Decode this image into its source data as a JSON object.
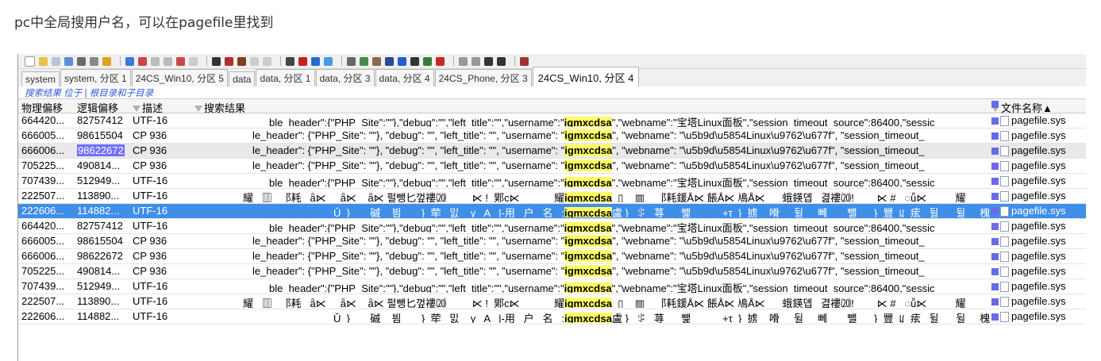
{
  "heading": "pc中全局搜用户名，可以在pagefile里找到",
  "tabs": [
    {
      "label": "system"
    },
    {
      "label": "system, 分区 1"
    },
    {
      "label": "24CS_Win10, 分区 5"
    },
    {
      "label": "data"
    },
    {
      "label": "data, 分区 1"
    },
    {
      "label": "data, 分区 3"
    },
    {
      "label": "data, 分区 4"
    },
    {
      "label": "24CS_Phone, 分区 3"
    },
    {
      "label": "24CS_Win10, 分区 4",
      "active": true
    }
  ],
  "breadcrumb": "搜索结果 位于 | 根目录和子目录",
  "columns": {
    "phys": "物理偏移",
    "logi": "逻辑偏移",
    "desc": "描述",
    "result": "搜索结果",
    "filename": "文件名称▲"
  },
  "keyword": "igmxcdsa",
  "rows": [
    {
      "phys": "664420...",
      "logi": "82757412",
      "desc": "UTF-16",
      "pre": "ble_header\":{\"PHP_Site\":\"\"},\"debug\":\"\",\"left_title\":\"\",\"username\":\"",
      "post": "\",\"webname\":\"宝塔Linux面板\",\"session_timeout_source\":86400,\"sessic",
      "file": "pagefile.sys"
    },
    {
      "phys": "666005...",
      "logi": "98615504",
      "desc": "CP 936",
      "pre": "le_header\": {\"PHP_Site\": \"\"}, \"debug\": \"\", \"left_title\": \"\", \"username\": \"",
      "post": "\", \"webname\": \"\\u5b9d\\u5854Linux\\u9762\\u677f\", \"session_timeout_",
      "file": "pagefile.sys"
    },
    {
      "phys": "666006...",
      "logi": "98622672",
      "desc": "CP 936",
      "pre": "le_header\": {\"PHP_Site\": \"\"}, \"debug\": \"\", \"left_title\": \"\", \"username\": \"",
      "post": "\", \"webname\": \"\\u5b9d\\u5854Linux\\u9762\\u677f\", \"session_timeout_",
      "file": "pagefile.sys",
      "logi_hl": true,
      "style": "hl2"
    },
    {
      "phys": "705225...",
      "logi": "490814...",
      "desc": "CP 936",
      "pre": "le_header\": {\"PHP_Site\": \"\"}, \"debug\": \"\", \"left_title\": \"\", \"username\": \"",
      "post": "\", \"webname\": \"\\u5b9d\\u5854Linux\\u9762\\u677f\", \"session_timeout_",
      "file": "pagefile.sys"
    },
    {
      "phys": "707439...",
      "logi": "512949...",
      "desc": "UTF-16",
      "pre": "ble_header\":{\"PHP_Site\":\"\"},\"debug\":\"\",\"left_title\":\"\",\"username\":\"",
      "post": "\",\"webname\":\"宝塔Linux面板\",\"session_timeout_source\":86400,\"sessic",
      "file": "pagefile.sys"
    },
    {
      "phys": "222507...",
      "logi": "113890...",
      "desc": "UTF-16",
      "pre": "耀   ▥   ⻏耗   ǟ⋉     ǟ⋉    ǟ⋉ 펄뺑⼔껖褸⒇         ⋉ !  郹c⋉            耀",
      "post": "  ▯    ▥    ⻏耗鍰Å⋉ 餦Å⋉ 鳰Å⋉      蛾鍈뎹   겶褸⒇!        ⋉ #   ◌ǚ⋉          耀",
      "file": "pagefile.sys"
    },
    {
      "phys": "222606...",
      "logi": "114882...",
      "desc": "UTF-16",
      "pre": "Ǔ  }       磩    븸       }  荦   밄    y   A   |-用   户   名   :",
      "post": "盧 }   ꌒ   荨      뺉           +τ  }  掳    嗗     뒬     뻬       뺄      }  豐  ꡊ  痃   뒬      뒬     槐   ꜰ",
      "file": "pagefile.sys",
      "style": "sel"
    },
    {
      "phys": "664420...",
      "logi": "82757412",
      "desc": "UTF-16",
      "pre": "ble_header\":{\"PHP_Site\":\"\"},\"debug\":\"\",\"left_title\":\"\",\"username\":\"",
      "post": "\",\"webname\":\"宝塔Linux面板\",\"session_timeout_source\":86400,\"sessic",
      "file": "pagefile.sys"
    },
    {
      "phys": "666005...",
      "logi": "98615504",
      "desc": "CP 936",
      "pre": "le_header\": {\"PHP_Site\": \"\"}, \"debug\": \"\", \"left_title\": \"\", \"username\": \"",
      "post": "\", \"webname\": \"\\u5b9d\\u5854Linux\\u9762\\u677f\", \"session_timeout_",
      "file": "pagefile.sys"
    },
    {
      "phys": "666006...",
      "logi": "98622672",
      "desc": "CP 936",
      "pre": "le_header\": {\"PHP_Site\": \"\"}, \"debug\": \"\", \"left_title\": \"\", \"username\": \"",
      "post": "\", \"webname\": \"\\u5b9d\\u5854Linux\\u9762\\u677f\", \"session_timeout_",
      "file": "pagefile.sys"
    },
    {
      "phys": "705225...",
      "logi": "490814...",
      "desc": "CP 936",
      "pre": "le_header\": {\"PHP_Site\": \"\"}, \"debug\": \"\", \"left_title\": \"\", \"username\": \"",
      "post": "\", \"webname\": \"\\u5b9d\\u5854Linux\\u9762\\u677f\", \"session_timeout_",
      "file": "pagefile.sys"
    },
    {
      "phys": "707439...",
      "logi": "512949...",
      "desc": "UTF-16",
      "pre": "ble_header\":{\"PHP_Site\":\"\"},\"debug\":\"\",\"left_title\":\"\",\"username\":\"",
      "post": "\",\"webname\":\"宝塔Linux面板\",\"session_timeout_source\":86400,\"sessic",
      "file": "pagefile.sys"
    },
    {
      "phys": "222507...",
      "logi": "113890...",
      "desc": "UTF-16",
      "pre": "耀   ▥   ⻏耗   ǟ⋉     ǟ⋉    ǟ⋉ 펄뺑⼔껖褸⒇         ⋉ !  郹c⋉            耀",
      "post": "  ▯    ▥    ⻏耗鍰Å⋉ 餦Å⋉ 鳰Å⋉      蛾鍈뎹   겶褸⒇!        ⋉ #   ◌ǚ⋉          耀",
      "file": "pagefile.sys"
    },
    {
      "phys": "222606...",
      "logi": "114882...",
      "desc": "UTF-16",
      "pre": "Ǔ  }       磩    븸       }  荦   밄    y   A   |-用   户   名   :",
      "post": "盧 }   ꌒ   荨      뺉           +τ  }  掳    嗗     뒬     뻬       뺄      }  豐  ꡊ  痃   뒬      뒬     槐   ꜰ",
      "file": "pagefile.sys"
    }
  ]
}
